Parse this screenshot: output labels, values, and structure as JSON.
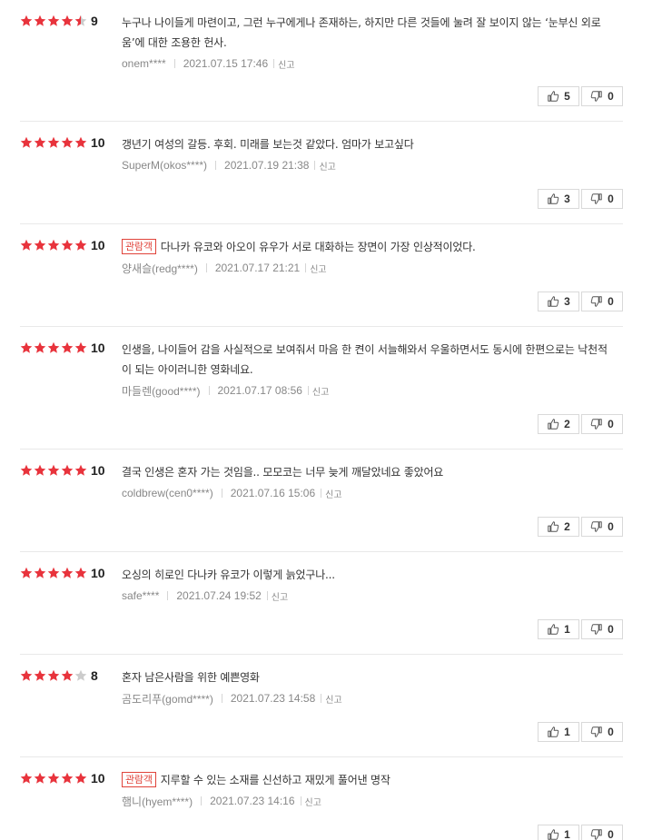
{
  "colors": {
    "star_on": "#e8333c",
    "star_off": "#cccccc",
    "badge": "#e0433a"
  },
  "labels": {
    "report": "신고"
  },
  "reviews": [
    {
      "stars": 4.5,
      "score": "9",
      "badge": "",
      "text": "누구나 나이들게 마련이고, 그런 누구에게나 존재하는, 하지만 다른 것들에 눌려 잘 보이지 않는 ‘눈부신 외로움’에 대한 조용한 헌사.",
      "user": "onem****",
      "date": "2021.07.15 17:46",
      "likes": "5",
      "dislikes": "0"
    },
    {
      "stars": 5,
      "score": "10",
      "badge": "",
      "text": "갱년기 여성의 갈등. 후회. 미래를 보는것 같았다. 엄마가 보고싶다",
      "user": "SuperM(okos****)",
      "date": "2021.07.19 21:38",
      "likes": "3",
      "dislikes": "0"
    },
    {
      "stars": 5,
      "score": "10",
      "badge": "관람객",
      "text": "다나카 유코와 아오이 유우가 서로 대화하는 장면이 가장 인상적이었다.",
      "user": "양새슬(redg****)",
      "date": "2021.07.17 21:21",
      "likes": "3",
      "dislikes": "0"
    },
    {
      "stars": 5,
      "score": "10",
      "badge": "",
      "text": "인생을, 나이들어 감을 사실적으로 보여줘서 마음 한 켠이 서늘해와서 우울하면서도 동시에 한편으로는 낙천적이 되는 아이러니한 영화네요.",
      "user": "마들렌(good****)",
      "date": "2021.07.17 08:56",
      "likes": "2",
      "dislikes": "0"
    },
    {
      "stars": 5,
      "score": "10",
      "badge": "",
      "text": "결국 인생은 혼자 가는 것임을.. 모모코는 너무 늦게 깨달았네요 좋았어요",
      "user": "coldbrew(cen0****)",
      "date": "2021.07.16 15:06",
      "likes": "2",
      "dislikes": "0"
    },
    {
      "stars": 5,
      "score": "10",
      "badge": "",
      "text": "오싱의 히로인 다나카 유코가 이렇게 늙었구나...",
      "user": "safe****",
      "date": "2021.07.24 19:52",
      "likes": "1",
      "dislikes": "0"
    },
    {
      "stars": 4,
      "score": "8",
      "badge": "",
      "text": "혼자 남은사람을 위한 예쁜영화",
      "user": "곰도리푸(gomd****)",
      "date": "2021.07.23 14:58",
      "likes": "1",
      "dislikes": "0"
    },
    {
      "stars": 5,
      "score": "10",
      "badge": "관람객",
      "text": "지루할 수 있는 소재를 신선하고 재밌게 풀어낸 명작",
      "user": "햄니(hyem****)",
      "date": "2021.07.23 14:16",
      "likes": "1",
      "dislikes": "0"
    }
  ]
}
